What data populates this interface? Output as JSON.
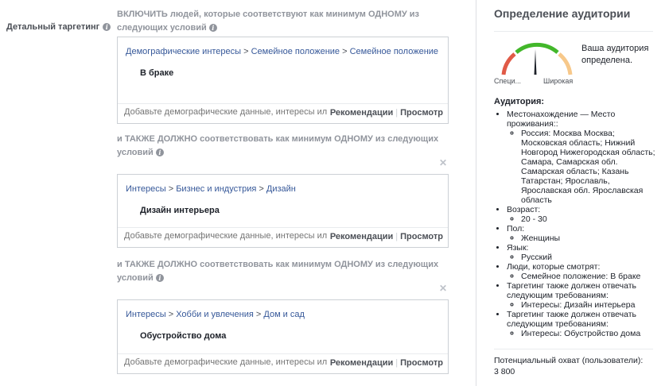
{
  "left": {
    "main_label": "Детальный таргетинг",
    "search_placeholder": "Добавьте демографические данные, интересы или поведение",
    "recommendations": "Рекомендации",
    "separator": "|",
    "browse": "Просмотр",
    "blocks": [
      {
        "heading": "ВКЛЮЧИТЬ людей, которые соответствуют как минимум ОДНОМУ из следующих условий",
        "crumbs": [
          "Демографические интересы",
          "Семейное положение",
          "Семейное положение"
        ],
        "item": "В браке"
      },
      {
        "heading": "и ТАКЖЕ ДОЛЖНО соответствовать как минимум ОДНОМУ из следующих условий",
        "crumbs": [
          "Интересы",
          "Бизнес и индустрия",
          "Дизайн"
        ],
        "item": "Дизайн интерьера"
      },
      {
        "heading": "и ТАКЖЕ ДОЛЖНО соответствовать как минимум ОДНОМУ из следующих условий",
        "crumbs": [
          "Интересы",
          "Хобби и увлечения",
          "Дом и сад"
        ],
        "item": "Обустройство дома"
      }
    ]
  },
  "right": {
    "title": "Определение аудитории",
    "gauge_left": "Специ...",
    "gauge_right": "Широкая",
    "gauge_status": "Ваша аудитория определена.",
    "audience_title": "Аудитория:",
    "audience": [
      {
        "label": "Местонахождение — Место проживания::",
        "sub": [
          "Россия: Москва Москва; Московская область; Нижний Новгород Нижегородская область; Самара, Самарская обл. Самарская область; Казань Татарстан; Ярославль, Ярославская обл. Ярославская область"
        ]
      },
      {
        "label": "Возраст:",
        "sub": [
          "20 - 30"
        ]
      },
      {
        "label": "Пол:",
        "sub": [
          "Женщины"
        ]
      },
      {
        "label": "Язык:",
        "sub": [
          "Русский"
        ]
      },
      {
        "label": "Люди, которые смотрят:",
        "sub": [
          "Семейное положение: В браке"
        ]
      },
      {
        "label": "Таргетинг также должен отвечать следующим требованиям:",
        "sub": [
          "Интересы: Дизайн интерьера"
        ]
      },
      {
        "label": "Таргетинг также должен отвечать следующим требованиям:",
        "sub": [
          "Интересы: Обустройство дома"
        ]
      }
    ],
    "reach_label": "Потенциальный охват (пользователи):",
    "reach_value": "3 800"
  },
  "colors": {
    "link": "#365899",
    "gauge_red": "#e05a47",
    "gauge_green": "#42b72a",
    "gauge_yellow": "#f7c88a"
  },
  "icons": {
    "info": "info-icon",
    "close": "close-icon",
    "needle": "gauge-needle"
  }
}
